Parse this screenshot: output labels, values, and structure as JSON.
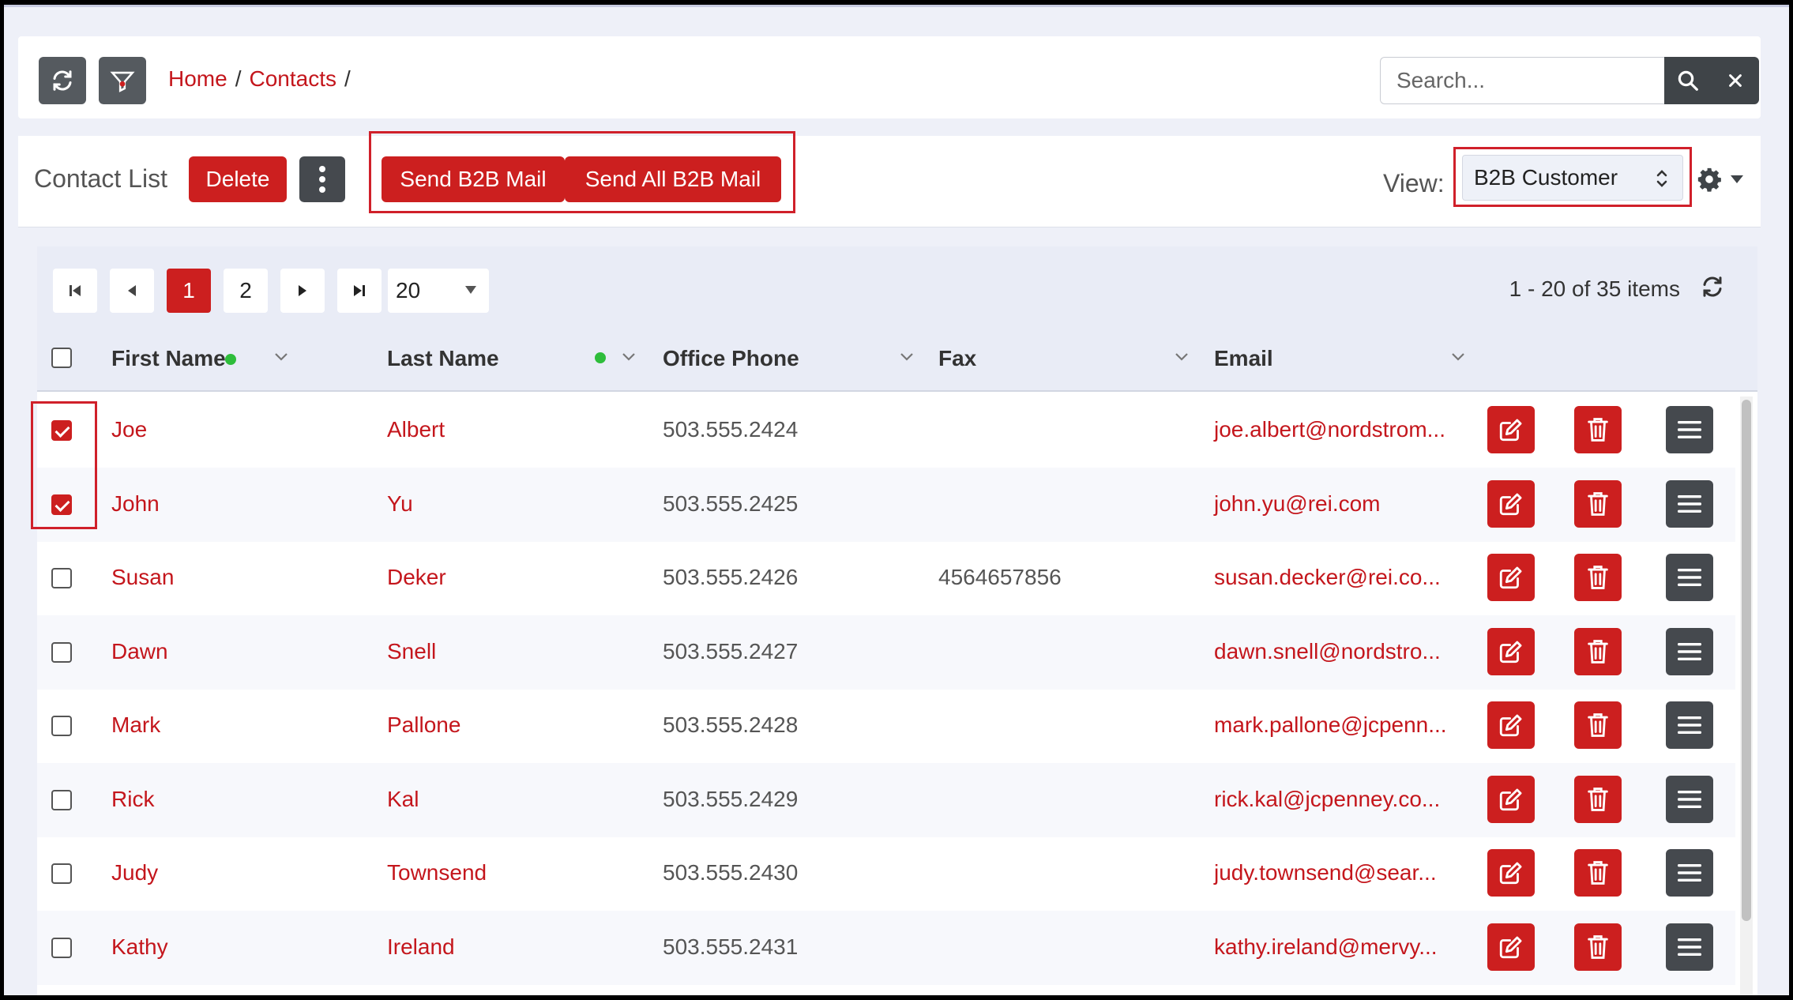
{
  "topbar": {
    "breadcrumb": [
      "Home",
      "Contacts"
    ],
    "separator": "/",
    "search_placeholder": "Search..."
  },
  "toolbar": {
    "title": "Contact List",
    "delete_label": "Delete",
    "send_b2b_label": "Send B2B Mail",
    "send_all_b2b_label": "Send All B2B Mail",
    "view_label": "View:",
    "view_value": "B2B Customer"
  },
  "pager": {
    "pages": [
      "1",
      "2"
    ],
    "current_page": "1",
    "page_size": "20",
    "info": "1 - 20 of 35 items"
  },
  "columns": {
    "first_name": "First Name",
    "last_name": "Last Name",
    "office_phone": "Office Phone",
    "fax": "Fax",
    "email": "Email"
  },
  "rows": [
    {
      "first": "Joe",
      "last": "Albert",
      "phone": "503.555.2424",
      "fax": "",
      "email": "joe.albert@nordstrom...",
      "checked": true
    },
    {
      "first": "John",
      "last": "Yu",
      "phone": "503.555.2425",
      "fax": "",
      "email": "john.yu@rei.com",
      "checked": true
    },
    {
      "first": "Susan",
      "last": "Deker",
      "phone": "503.555.2426",
      "fax": "4564657856",
      "email": "susan.decker@rei.co...",
      "checked": false
    },
    {
      "first": "Dawn",
      "last": "Snell",
      "phone": "503.555.2427",
      "fax": "",
      "email": "dawn.snell@nordstro...",
      "checked": false
    },
    {
      "first": "Mark",
      "last": "Pallone",
      "phone": "503.555.2428",
      "fax": "",
      "email": "mark.pallone@jcpenn...",
      "checked": false
    },
    {
      "first": "Rick",
      "last": "Kal",
      "phone": "503.555.2429",
      "fax": "",
      "email": "rick.kal@jcpenney.co...",
      "checked": false
    },
    {
      "first": "Judy",
      "last": "Townsend",
      "phone": "503.555.2430",
      "fax": "",
      "email": "judy.townsend@sear...",
      "checked": false
    },
    {
      "first": "Kathy",
      "last": "Ireland",
      "phone": "503.555.2431",
      "fax": "",
      "email": "kathy.ireland@mervy...",
      "checked": false
    }
  ],
  "colors": {
    "accent": "#cc1f1f",
    "link": "#c4161c",
    "dark_button": "#45494e",
    "sort_dot": "#2ebd3b"
  }
}
